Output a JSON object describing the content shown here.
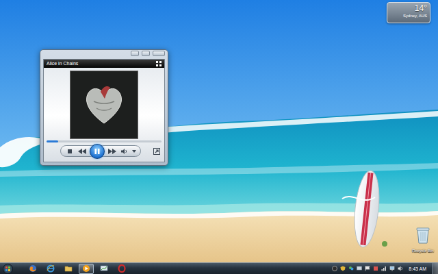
{
  "weather_gadget": {
    "temperature": "14°",
    "location": "Sydney, AUS"
  },
  "player_window": {
    "title": "Alice in Chains",
    "playing": true,
    "progress": {
      "level": 0.1
    }
  },
  "desktop_icons": [
    {
      "label": "Recycle Bin"
    }
  ],
  "taskbar": {
    "buttons": [
      {
        "selected": false
      },
      {
        "selected": false
      },
      {
        "selected": false
      },
      {
        "selected": true
      },
      {
        "selected": false
      },
      {
        "selected": false
      }
    ],
    "clock": "8:43 AM"
  }
}
